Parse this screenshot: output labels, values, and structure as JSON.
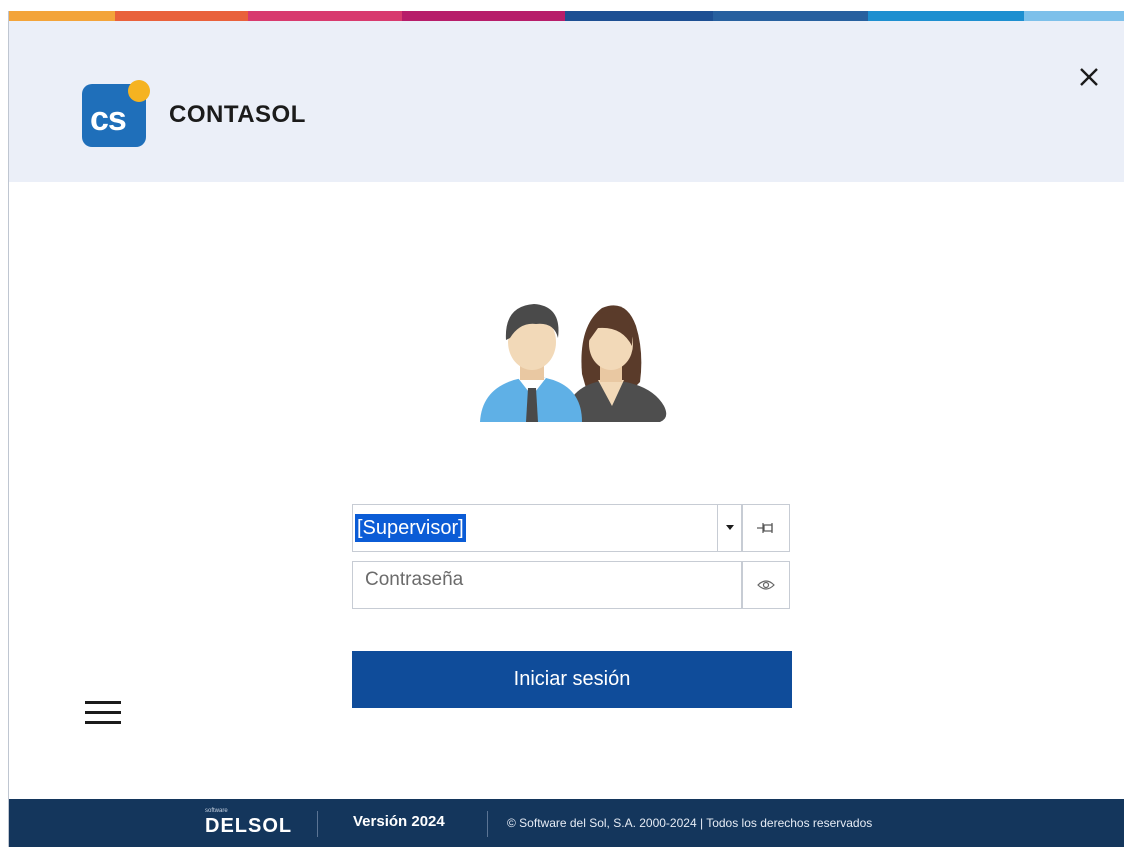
{
  "app": {
    "title": "CONTASOL",
    "logo_text": "cs"
  },
  "login": {
    "user_value": "[Supervisor]",
    "password_placeholder": "Contraseña",
    "submit_label": "Iniciar sesión"
  },
  "footer": {
    "brand_small": "software",
    "brand": "DELSOL",
    "version": "Versión 2024",
    "copyright": "© Software del Sol, S.A. 2000-2024  |  Todos los derechos reservados"
  },
  "icons": {
    "close": "close-icon",
    "dropdown": "chevron-down-icon",
    "pin": "pin-icon",
    "show_password": "eye-icon",
    "menu": "hamburger-menu-icon",
    "avatar": "users-icon"
  },
  "colors": {
    "header_bg": "#ebeff8",
    "primary_button": "#0f4c9a",
    "footer_bg": "#14365c",
    "logo_blue": "#1f6fba",
    "logo_dot": "#f5b321",
    "selection": "#0b5cd6",
    "accent_bar": [
      "#f3a43a",
      "#e9613b",
      "#d83a6e",
      "#b71d6a",
      "#1d4f93",
      "#27609f",
      "#1d8fd0",
      "#7dc0ea"
    ]
  }
}
